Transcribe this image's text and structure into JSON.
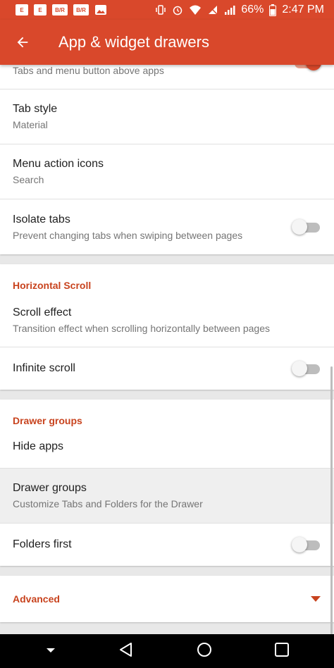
{
  "status_bar": {
    "notif_icons": [
      "E",
      "E",
      "B/R",
      "B/R"
    ],
    "battery": "66%",
    "time": "2:47 PM"
  },
  "appbar": {
    "title": "App & widget drawers"
  },
  "tabs_section": {
    "partial_subtitle": "Tabs and menu button above apps",
    "partial_toggle_on": true,
    "rows": [
      {
        "title": "Tab style",
        "subtitle": "Material"
      },
      {
        "title": "Menu action icons",
        "subtitle": "Search"
      },
      {
        "title": "Isolate tabs",
        "subtitle": "Prevent changing tabs when swiping between pages",
        "toggle_on": false
      }
    ]
  },
  "horizontal_scroll": {
    "header": "Horizontal Scroll",
    "scroll_effect": {
      "title": "Scroll effect",
      "subtitle": "Transition effect when scrolling horizontally between pages"
    },
    "infinite_scroll": {
      "title": "Infinite scroll",
      "toggle_on": false
    }
  },
  "drawer_groups": {
    "header": "Drawer groups",
    "hide_apps": {
      "title": "Hide apps"
    },
    "drawer_groups_row": {
      "title": "Drawer groups",
      "subtitle": "Customize Tabs and Folders for the Drawer"
    },
    "folders_first": {
      "title": "Folders first",
      "toggle_on": false
    }
  },
  "advanced": {
    "label": "Advanced"
  },
  "colors": {
    "accent": "#d9482b",
    "section_header": "#c8431e"
  }
}
